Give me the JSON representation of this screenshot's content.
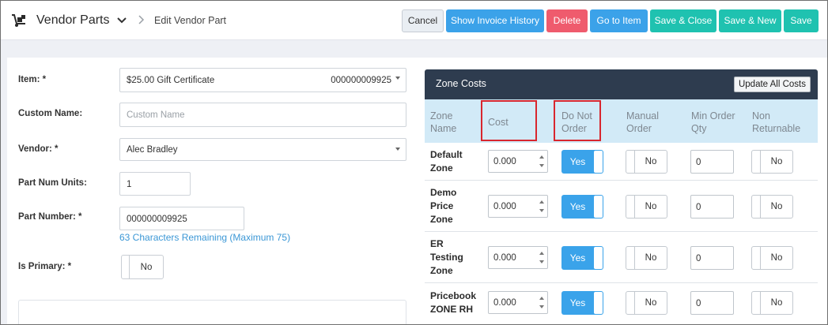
{
  "header": {
    "app_title": "Vendor Parts",
    "breadcrumb_current": "Edit Vendor Part",
    "buttons": {
      "cancel": "Cancel",
      "show_invoice_history": "Show Invoice History",
      "delete": "Delete",
      "go_to_item": "Go to Item",
      "save_close": "Save & Close",
      "save_new": "Save & New",
      "save": "Save"
    },
    "colors": {
      "blue": "#3ba2e9",
      "red": "#ef5b6d",
      "teal": "#1fc2b0"
    }
  },
  "form": {
    "item": {
      "label": "Item: *",
      "value": "$25.00 Gift Certificate",
      "code": "000000009925"
    },
    "custom_name": {
      "label": "Custom Name:",
      "placeholder": "Custom Name",
      "value": ""
    },
    "vendor": {
      "label": "Vendor: *",
      "value": "Alec Bradley"
    },
    "part_num_units": {
      "label": "Part Num Units:",
      "value": "1"
    },
    "part_number": {
      "label": "Part Number: *",
      "value": "000000009925",
      "helper": "63 Characters Remaining (Maximum 75)"
    },
    "is_primary": {
      "label": "Is Primary: *",
      "value": "No"
    }
  },
  "zone_costs": {
    "title": "Zone Costs",
    "update_all_label": "Update All Costs",
    "columns": {
      "zone_name": "Zone\nName",
      "cost": "Cost",
      "do_not_order": "Do Not\nOrder",
      "manual_order": "Manual\nOrder",
      "min_order_qty": "Min Order\nQty",
      "non_returnable": "Non\nReturnable"
    },
    "rows": [
      {
        "name": "Default Zone",
        "cost": "0.000",
        "do_not_order": "Yes",
        "manual_order": "No",
        "min_order_qty": "0",
        "non_returnable": "No"
      },
      {
        "name": "Demo Price Zone",
        "cost": "0.000",
        "do_not_order": "Yes",
        "manual_order": "No",
        "min_order_qty": "0",
        "non_returnable": "No"
      },
      {
        "name": "ER Testing Zone",
        "cost": "0.000",
        "do_not_order": "Yes",
        "manual_order": "No",
        "min_order_qty": "0",
        "non_returnable": "No"
      },
      {
        "name": "Pricebook ZONE RH",
        "cost": "0.000",
        "do_not_order": "Yes",
        "manual_order": "No",
        "min_order_qty": "0",
        "non_returnable": "No"
      }
    ],
    "highlight_color": "#d8262e"
  }
}
